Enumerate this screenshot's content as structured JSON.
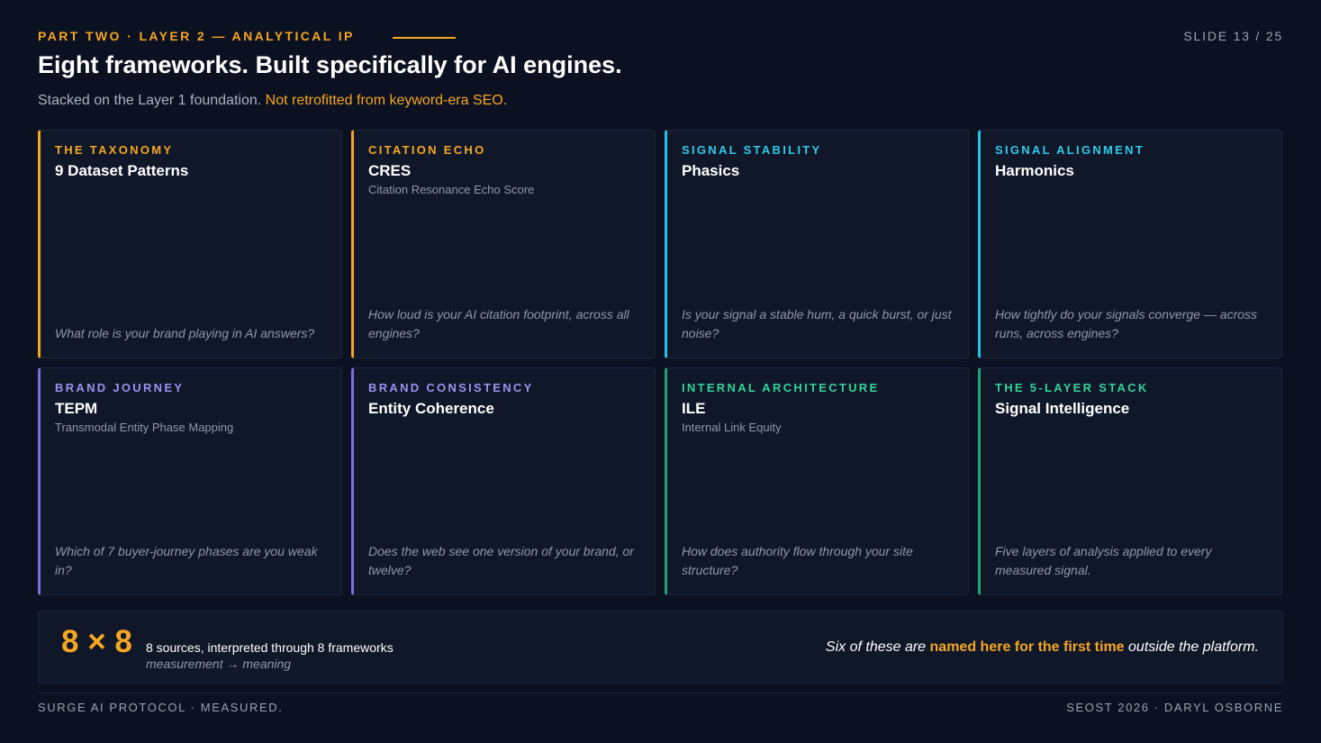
{
  "header": {
    "eyebrow": "PART TWO · LAYER 2 — ANALYTICAL IP",
    "slide_number": "SLIDE 13 / 25",
    "title": "Eight frameworks. Built specifically for AI engines.",
    "subtitle_plain": "Stacked on the Layer 1 foundation.",
    "subtitle_accent": "Not retrofitted from keyword-era SEO."
  },
  "colors": {
    "background": "#0b1120",
    "card": "#0f1729",
    "orange": "#f5a623",
    "cyan": "#22c3e6",
    "purple": "#7c6fe0",
    "green": "#1fa37a"
  },
  "cards": [
    {
      "kicker": "THE TAXONOMY",
      "name": "9 Dataset Patterns",
      "fullname": "",
      "question": "What role is your brand playing in AI answers?"
    },
    {
      "kicker": "CITATION ECHO",
      "name": "CRES",
      "fullname": "Citation Resonance Echo Score",
      "question": "How loud is your AI citation footprint, across all engines?"
    },
    {
      "kicker": "SIGNAL STABILITY",
      "name": "Phasics",
      "fullname": "",
      "question": "Is your signal a stable hum, a quick burst, or just noise?"
    },
    {
      "kicker": "SIGNAL ALIGNMENT",
      "name": "Harmonics",
      "fullname": "",
      "question": "How tightly do your signals converge — across runs, across engines?"
    },
    {
      "kicker": "BRAND JOURNEY",
      "name": "TEPM",
      "fullname": "Transmodal Entity Phase Mapping",
      "question": "Which of 7 buyer-journey phases are you weak in?"
    },
    {
      "kicker": "BRAND CONSISTENCY",
      "name": "Entity Coherence",
      "fullname": "",
      "question": "Does the web see one version of your brand, or twelve?"
    },
    {
      "kicker": "INTERNAL ARCHITECTURE",
      "name": "ILE",
      "fullname": "Internal Link Equity",
      "question": "How does authority flow through your site structure?"
    },
    {
      "kicker": "THE 5-LAYER STACK",
      "name": "Signal Intelligence",
      "fullname": "",
      "question": "Five layers of analysis applied to every measured signal."
    }
  ],
  "summary": {
    "big": "8 × 8",
    "line1": "8 sources, interpreted through 8 frameworks",
    "line2": "measurement → meaning",
    "right_pre": "Six of these are",
    "right_highlight": "named here for the first time",
    "right_post": "outside the platform."
  },
  "footer": {
    "left": "SURGE AI PROTOCOL · MEASURED.",
    "right": "SEOST 2026 · DARYL OSBORNE"
  }
}
